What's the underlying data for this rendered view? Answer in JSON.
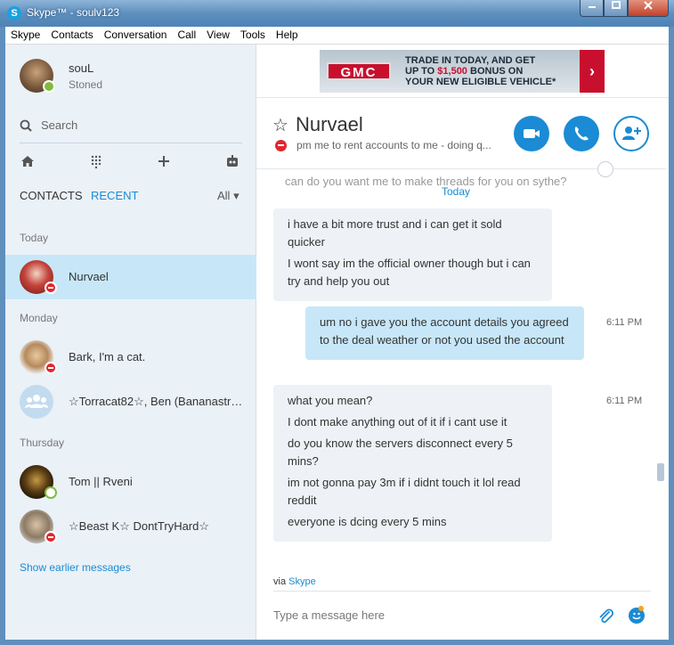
{
  "window": {
    "title": "Skype™ - soulv123",
    "app_icon_glyph": "S",
    "buttons": [
      "minimize",
      "maximize",
      "close"
    ]
  },
  "menu": [
    "Skype",
    "Contacts",
    "Conversation",
    "Call",
    "View",
    "Tools",
    "Help"
  ],
  "profile": {
    "name": "souL",
    "status": "Stoned",
    "presence": "online"
  },
  "search": {
    "label": "Search"
  },
  "toolbar_icons": [
    "home-icon",
    "dialpad-icon",
    "plus-icon",
    "bot-icon"
  ],
  "tabs": {
    "contacts": "CONTACTS",
    "recent": "RECENT",
    "all": "All"
  },
  "sections": {
    "today": "Today",
    "monday": "Monday",
    "thursday": "Thursday"
  },
  "contacts": [
    {
      "name": "Nurvael",
      "presence": "dnd",
      "selected": true
    },
    {
      "name": "Bark, I'm a cat.",
      "presence": "dnd"
    },
    {
      "name": "☆Torracat82☆, Ben (Bananastr…",
      "presence": "group"
    },
    {
      "name": "Tom || Rveni",
      "presence": "away"
    },
    {
      "name": "☆Beast K☆ DontTryHard☆",
      "presence": "dnd"
    }
  ],
  "show_earlier": "Show earlier messages",
  "ad": {
    "brand": "GMC",
    "line1": "TRADE IN TODAY, AND GET",
    "line2_pre": "UP TO ",
    "line2_amount": "$1,500",
    "line2_post": " BONUS ON",
    "line3": "YOUR NEW ELIGIBLE VEHICLE*",
    "arrow": "›"
  },
  "conversation": {
    "name": "Nurvael",
    "mood": "pm me to rent accounts to me - doing q..."
  },
  "chat": {
    "today_label": "Today",
    "ghost_line": "can do you want me to make threads for you on sythe?",
    "bubbles": [
      {
        "dir": "in",
        "lines": [
          "i have a bit more trust and i can get it sold quicker",
          "I wont say im the official owner though but i can try and help you out"
        ],
        "time": ""
      },
      {
        "dir": "out",
        "lines": [
          "um no i gave you the account details you agreed to the deal weather or not you used the account"
        ],
        "time": "6:11 PM"
      },
      {
        "dir": "in",
        "lines": [
          "what you mean?",
          "I dont make anything out of it if i cant use it",
          "do you know the servers disconnect every 5 mins?",
          "im not gonna pay 3m if i didnt touch it lol read reddit",
          "everyone is dcing every 5 mins"
        ],
        "time": "6:11 PM"
      }
    ]
  },
  "footer": {
    "via_prefix": "via ",
    "via_link": "Skype",
    "input_placeholder": "Type a message here"
  },
  "colors": {
    "accent": "#1a8bd4",
    "selected_row": "#c7e7f8",
    "outgoing_bubble": "#c7e7f8",
    "incoming_bubble": "#eef2f6",
    "dnd": "#e0262f",
    "online": "#7fbb3e"
  }
}
